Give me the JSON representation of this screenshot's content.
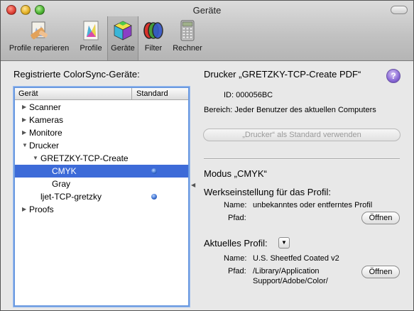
{
  "window": {
    "title": "Geräte"
  },
  "toolbar": {
    "items": [
      {
        "label": "Profile reparieren",
        "icon": "repair-profile-icon"
      },
      {
        "label": "Profile",
        "icon": "profile-icon"
      },
      {
        "label": "Geräte",
        "icon": "devices-cube-icon",
        "selected": true
      },
      {
        "label": "Filter",
        "icon": "filter-icon"
      },
      {
        "label": "Rechner",
        "icon": "calculator-icon"
      }
    ]
  },
  "left": {
    "title": "Registrierte ColorSync-Geräte:",
    "columns": {
      "device": "Gerät",
      "standard": "Standard"
    },
    "rows": [
      {
        "label": "Scanner",
        "triangle": "▶"
      },
      {
        "label": "Kameras",
        "triangle": "▶"
      },
      {
        "label": "Monitore",
        "triangle": "▶"
      },
      {
        "label": "Drucker",
        "triangle": "▼"
      },
      {
        "label": "GRETZKY-TCP-Create",
        "triangle": "▼"
      },
      {
        "label": "CMYK",
        "default": true,
        "selected": true
      },
      {
        "label": "Gray"
      },
      {
        "label": "ljet-TCP-gretzky",
        "default": true
      },
      {
        "label": "Proofs",
        "triangle": "▶"
      }
    ]
  },
  "right": {
    "heading": "Drucker „GRETZKY-TCP-Create PDF“",
    "help": "?",
    "id_line": "ID: 000056BC",
    "bereich_line": "Bereich: Jeder Benutzer des aktuellen Computers",
    "default_button": "„Drucker“ als Standard verwenden",
    "mode_heading": "Modus „CMYK“",
    "factory": {
      "heading": "Werkseinstellung für das Profil:",
      "name_label": "Name:",
      "name_value": "unbekanntes oder entferntes Profil",
      "path_label": "Pfad:",
      "open_button": "Öffnen"
    },
    "current": {
      "heading": "Aktuelles Profil:",
      "popup": "▼",
      "name_label": "Name:",
      "name_value": "U.S. Sheetfed Coated v2",
      "path_label": "Pfad:",
      "path_value_1": "/Library/Application",
      "path_value_2": "Support/Adobe/Color/",
      "open_button": "Öffnen"
    }
  }
}
